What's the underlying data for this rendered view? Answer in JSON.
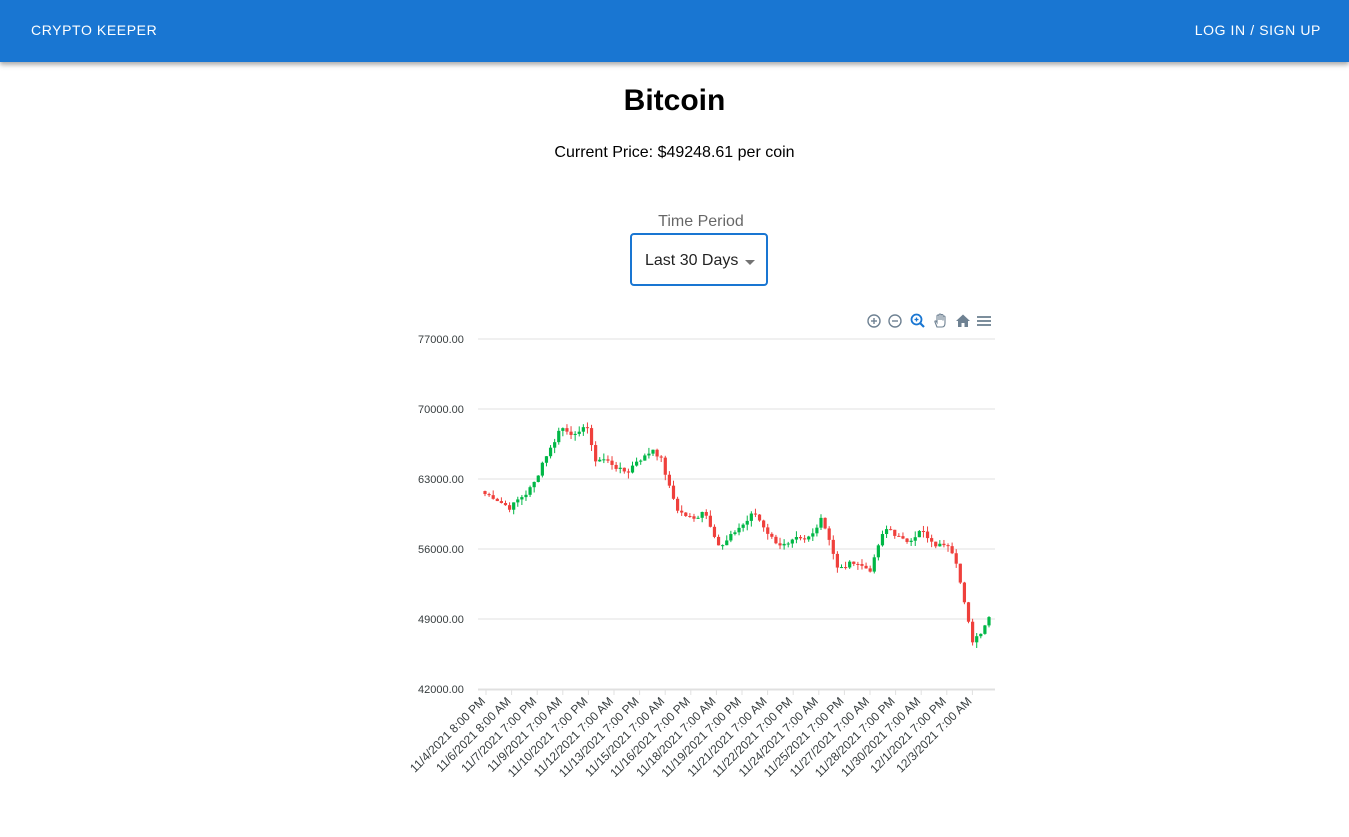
{
  "appbar": {
    "brand": "CRYPTO KEEPER",
    "login": "LOG IN / SIGN UP",
    "color": "#1976d2"
  },
  "page": {
    "title": "Bitcoin",
    "current_price": "Current Price: $49248.61 per coin"
  },
  "time_period": {
    "label": "Time Period",
    "selected": "Last 30 Days"
  },
  "toolbar": {
    "icons": [
      "zoom-in-icon",
      "zoom-out-icon",
      "zoom-selection-icon",
      "pan-hand-icon",
      "reset-home-icon",
      "menu-icon"
    ]
  },
  "chart_data": {
    "type": "candlestick",
    "ylim": [
      42000,
      77000
    ],
    "y_ticks": [
      "77000.00",
      "70000.00",
      "63000.00",
      "56000.00",
      "49000.00",
      "42000.00"
    ],
    "x_ticks": [
      "11/4/2021 8:00 PM",
      "11/6/2021 8:00 AM",
      "11/7/2021 7:00 PM",
      "11/9/2021 7:00 AM",
      "11/10/2021 7:00 PM",
      "11/12/2021 7:00 AM",
      "11/13/2021 7:00 PM",
      "11/15/2021 7:00 AM",
      "11/16/2021 7:00 PM",
      "11/18/2021 7:00 AM",
      "11/19/2021 7:00 PM",
      "11/21/2021 7:00 AM",
      "11/22/2021 7:00 PM",
      "11/24/2021 7:00 AM",
      "11/25/2021 7:00 PM",
      "11/27/2021 7:00 AM",
      "11/28/2021 7:00 PM",
      "11/30/2021 7:00 AM",
      "12/1/2021 7:00 PM",
      "12/3/2021 7:00 AM"
    ],
    "up_color": "#00b746",
    "down_color": "#ef403c",
    "key_closes": [
      61500,
      61200,
      60600,
      60100,
      61000,
      61600,
      62800,
      65000,
      66300,
      68200,
      67800,
      67100,
      68900,
      64900,
      65000,
      64600,
      63900,
      63700,
      64800,
      65200,
      66000,
      64900,
      62000,
      59800,
      59300,
      58900,
      60000,
      58100,
      56000,
      57000,
      58000,
      58600,
      59700,
      58500,
      57200,
      56500,
      56300,
      57000,
      56800,
      57500,
      59200,
      57000,
      53900,
      54300,
      54800,
      54200,
      53900,
      56900,
      58200,
      57300,
      56700,
      57200,
      57900,
      56600,
      56300,
      56700,
      55200,
      50800,
      46800,
      47700,
      49200
    ]
  }
}
